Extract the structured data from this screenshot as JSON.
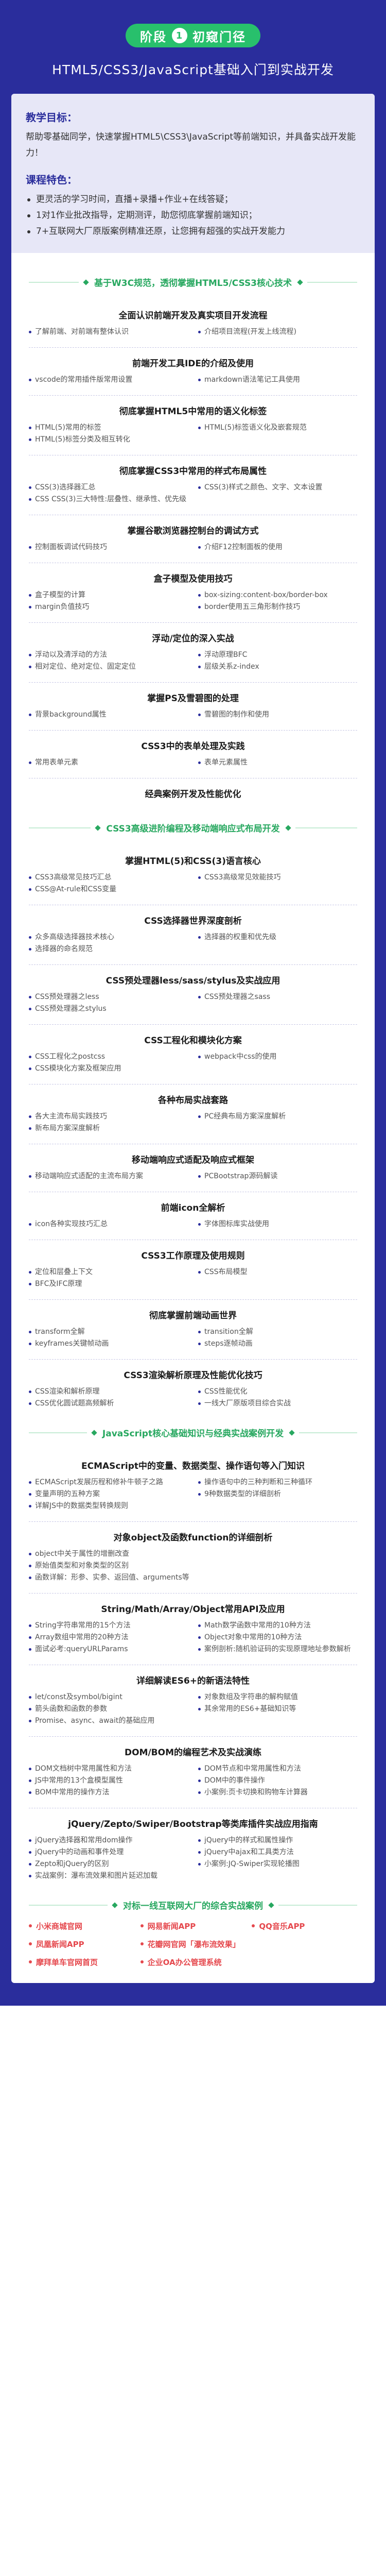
{
  "phase": {
    "prefix": "阶段",
    "num": "1",
    "title": "初窥门径"
  },
  "subtitle": "HTML5/CSS3/JavaScript基础入门到实战开发",
  "intro": {
    "goal_title": "教学目标：",
    "goal_text": "帮助零基础同学，快速掌握HTML5\\CSS3\\JavaScript等前端知识，并具备实战开发能力！",
    "feature_title": "课程特色：",
    "features": [
      "更灵活的学习时间，直播+录播+作业+在线答疑；",
      "1对1作业批改指导，定期测评，助您彻底掌握前端知识；",
      "7+互联网大厂原版案例精准还原，让您拥有超强的实战开发能力"
    ]
  },
  "banners": {
    "b1": "基于W3C规范，透彻掌握HTML5/CSS3核心技术",
    "b2": "CSS3高级进阶编程及移动端响应式布局开发",
    "b3": "JavaScript核心基础知识与经典实战案例开发",
    "b4": "对标一线互联网大厂的综合实战案例"
  },
  "s1": [
    {
      "title": "全面认识前端开发及真实项目开发流程",
      "items": [
        "了解前端、对前端有整体认识",
        "介绍项目流程(开发上线流程)"
      ]
    },
    {
      "title": "前端开发工具IDE的介绍及使用",
      "items": [
        "vscode的常用插件版常用设置",
        "markdown语法笔记工具使用"
      ]
    },
    {
      "title": "彻底掌握HTML5中常用的语义化标签",
      "items": [
        "HTML(5)常用的标签",
        "HTML(5)标签语义化及嵌套规范",
        "HTML(5)标签分类及相互转化"
      ]
    },
    {
      "title": "彻底掌握CSS3中常用的样式布局属性",
      "items": [
        "CSS(3)选择器汇总",
        "CSS(3)样式之颜色、文字、文本设置",
        "CSS CSS(3)三大特性:层叠性、继承性、优先级"
      ]
    },
    {
      "title": "掌握谷歌浏览器控制台的调试方式",
      "items": [
        "控制面板调试代码技巧",
        "介绍F12控制面板的使用"
      ]
    },
    {
      "title": "盒子模型及使用技巧",
      "items": [
        "盒子模型的计算",
        "box-sizing:content-box/border-box",
        "margin负值技巧",
        "border使用五三角形制作技巧"
      ]
    },
    {
      "title": "浮动/定位的深入实战",
      "items": [
        "浮动以及清浮动的方法",
        "浮动原理BFC",
        "相对定位、绝对定位、固定定位",
        "层级关系z-index"
      ]
    },
    {
      "title": "掌握PS及雪碧图的处理",
      "items": [
        "背景background属性",
        "雪碧图的制作和使用"
      ]
    },
    {
      "title": "CSS3中的表单处理及实践",
      "items": [
        "常用表单元素",
        "表单元素属性"
      ]
    },
    {
      "title": "经典案例开发及性能优化",
      "items": []
    }
  ],
  "s2": [
    {
      "title": "掌握HTML(5)和CSS(3)语言核心",
      "items": [
        "CSS3高级常见技巧汇总",
        "CSS3高级常见效能技巧",
        "CSS@At-rule和CSS变量"
      ]
    },
    {
      "title": "CSS选择器世界深度剖析",
      "items": [
        "众多高级选择器技术核心",
        "选择器的权重和优先级",
        "选择器的命名规范"
      ]
    },
    {
      "title": "CSS预处理器less/sass/stylus及实战应用",
      "items": [
        "CSS预处理器之less",
        "CSS预处理器之sass",
        "CSS预处理器之stylus"
      ]
    },
    {
      "title": "CSS工程化和模块化方案",
      "items": [
        "CSS工程化之postcss",
        "webpack中css的使用",
        "CSS模块化方案及框架应用"
      ]
    },
    {
      "title": "各种布局实战套路",
      "items": [
        "各大主流布局实践技巧",
        "PC经典布局方案深度解析",
        "新布局方案深度解析"
      ]
    },
    {
      "title": "移动端响应式适配及响应式框架",
      "items": [
        "移动端响应式适配的主流布局方案",
        "PCBootstrap源码解读"
      ]
    },
    {
      "title": "前端icon全解析",
      "items": [
        "icon各种实现技巧汇总",
        "字体图标库实战使用"
      ]
    },
    {
      "title": "CSS3工作原理及使用规则",
      "items": [
        "定位和层叠上下文",
        "CSS布局模型",
        "BFC及IFC原理"
      ]
    },
    {
      "title": "彻底掌握前端动画世界",
      "items": [
        "transform全解",
        "transition全解",
        "keyframes关键帧动画",
        "steps逐帧动画"
      ]
    },
    {
      "title": "CSS3渲染解析原理及性能优化技巧",
      "items": [
        "CSS渲染和解析原理",
        "CSS性能优化",
        "CSS优化圆试题高频解析",
        "一线大厂原版项目综合实战"
      ]
    }
  ],
  "s3": [
    {
      "title": "ECMAScript中的变量、数据类型、操作语句等入门知识",
      "items": [
        "ECMAScript发展历程和修补牛顿子之路",
        "操作语句中的三种判断和三种循环",
        "变量声明的五种方案",
        "9种数据类型的详细剖析",
        "详解JS中的数据类型转换规则"
      ]
    },
    {
      "title": "对象object及函数function的详细剖析",
      "items": [
        "object中关于属性的增删改查",
        "原始值类型和对象类型的区别",
        "函数详解：形参、实参、返回值、arguments等"
      ],
      "single": true
    },
    {
      "title": "String/Math/Array/Object常用API及应用",
      "items": [
        "String字符串常用的15个方法",
        "Math数学函数中常用的10种方法",
        "Array数组中常用的20种方法",
        "Object对象中常用的10种方法",
        "面试必考:queryURLParams",
        "案例剖析:随机验证码的实现原理地址参数解析"
      ]
    },
    {
      "title": "详细解读ES6+的新语法特性",
      "items": [
        "let/const及symbol/bigint",
        "对象数组及字符串的解构赋值",
        "箭头函数和函数的参数",
        "其余常用的ES6+基础知识等",
        "Promise、async、await的基础应用"
      ]
    },
    {
      "title": "DOM/BOM的编程艺术及实战演练",
      "items": [
        "DOM文档树中常用属性和方法",
        "DOM节点和中常用属性和方法",
        "JS中常用的13个盒模型属性",
        "DOM中的事件操作",
        "BOM中常用的操作方法",
        "小案例:页卡切换和购物车计算器"
      ]
    },
    {
      "title": "jQuery/Zepto/Swiper/Bootstrap等类库插件实战应用指南",
      "items": [
        "jQuery选择器和常用dom操作",
        "jQuery中的样式和属性操作",
        "jQuery中的动画和事件处理",
        "jQuery中ajax和工具类方法",
        "Zepto和jQuery的区别",
        "小案例:JQ-Swiper实现轮播图",
        "实战案例：瀑布流效果和图片延迟加载"
      ]
    }
  ],
  "cases": [
    "小米商城官网",
    "网易新闻APP",
    "QQ音乐APP",
    "凤凰新闻APP",
    "花瓣网官网「瀑布流效果」",
    "",
    "摩拜单车官网首页",
    "企业OA办公管理系统",
    ""
  ]
}
